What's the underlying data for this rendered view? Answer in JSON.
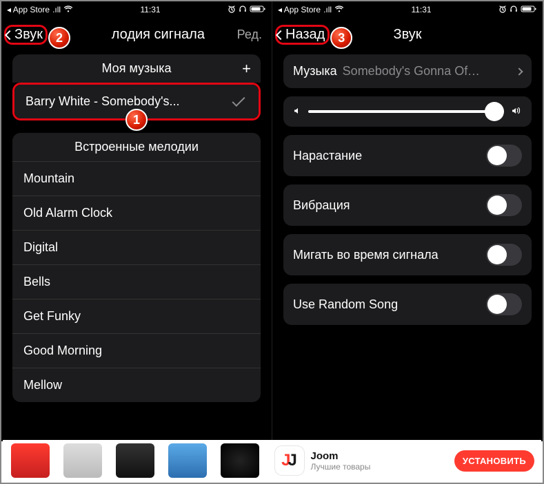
{
  "status": {
    "appstore": "◂ App Store",
    "time": "11:31"
  },
  "left": {
    "nav": {
      "back": "Звук",
      "title": "лодия сигнала",
      "right": "Ред."
    },
    "my_music_header": "Моя музыка",
    "selected_song": "Barry White -  Somebody's...",
    "builtin_header": "Встроенные мелодии",
    "builtin": [
      "Mountain",
      "Old Alarm Clock",
      "Digital",
      "Bells",
      "Get Funky",
      "Good Morning",
      "Mellow"
    ]
  },
  "right": {
    "nav": {
      "back": "Назад",
      "title": "Звук"
    },
    "music_label": "Музыка",
    "music_value": "Somebody's Gonna Off...",
    "rows": {
      "rise": "Нарастание",
      "vibration": "Вибрация",
      "flash": "Мигать во время сигнала",
      "random": "Use Random Song"
    },
    "switches": {
      "rise": false,
      "vibration": false,
      "flash": false,
      "random": false
    }
  },
  "ad": {
    "joom_name": "Joom",
    "joom_sub": "Лучшие товары",
    "install": "УСТАНОВИТЬ"
  },
  "markers": {
    "m1": "1",
    "m2": "2",
    "m3": "3"
  }
}
